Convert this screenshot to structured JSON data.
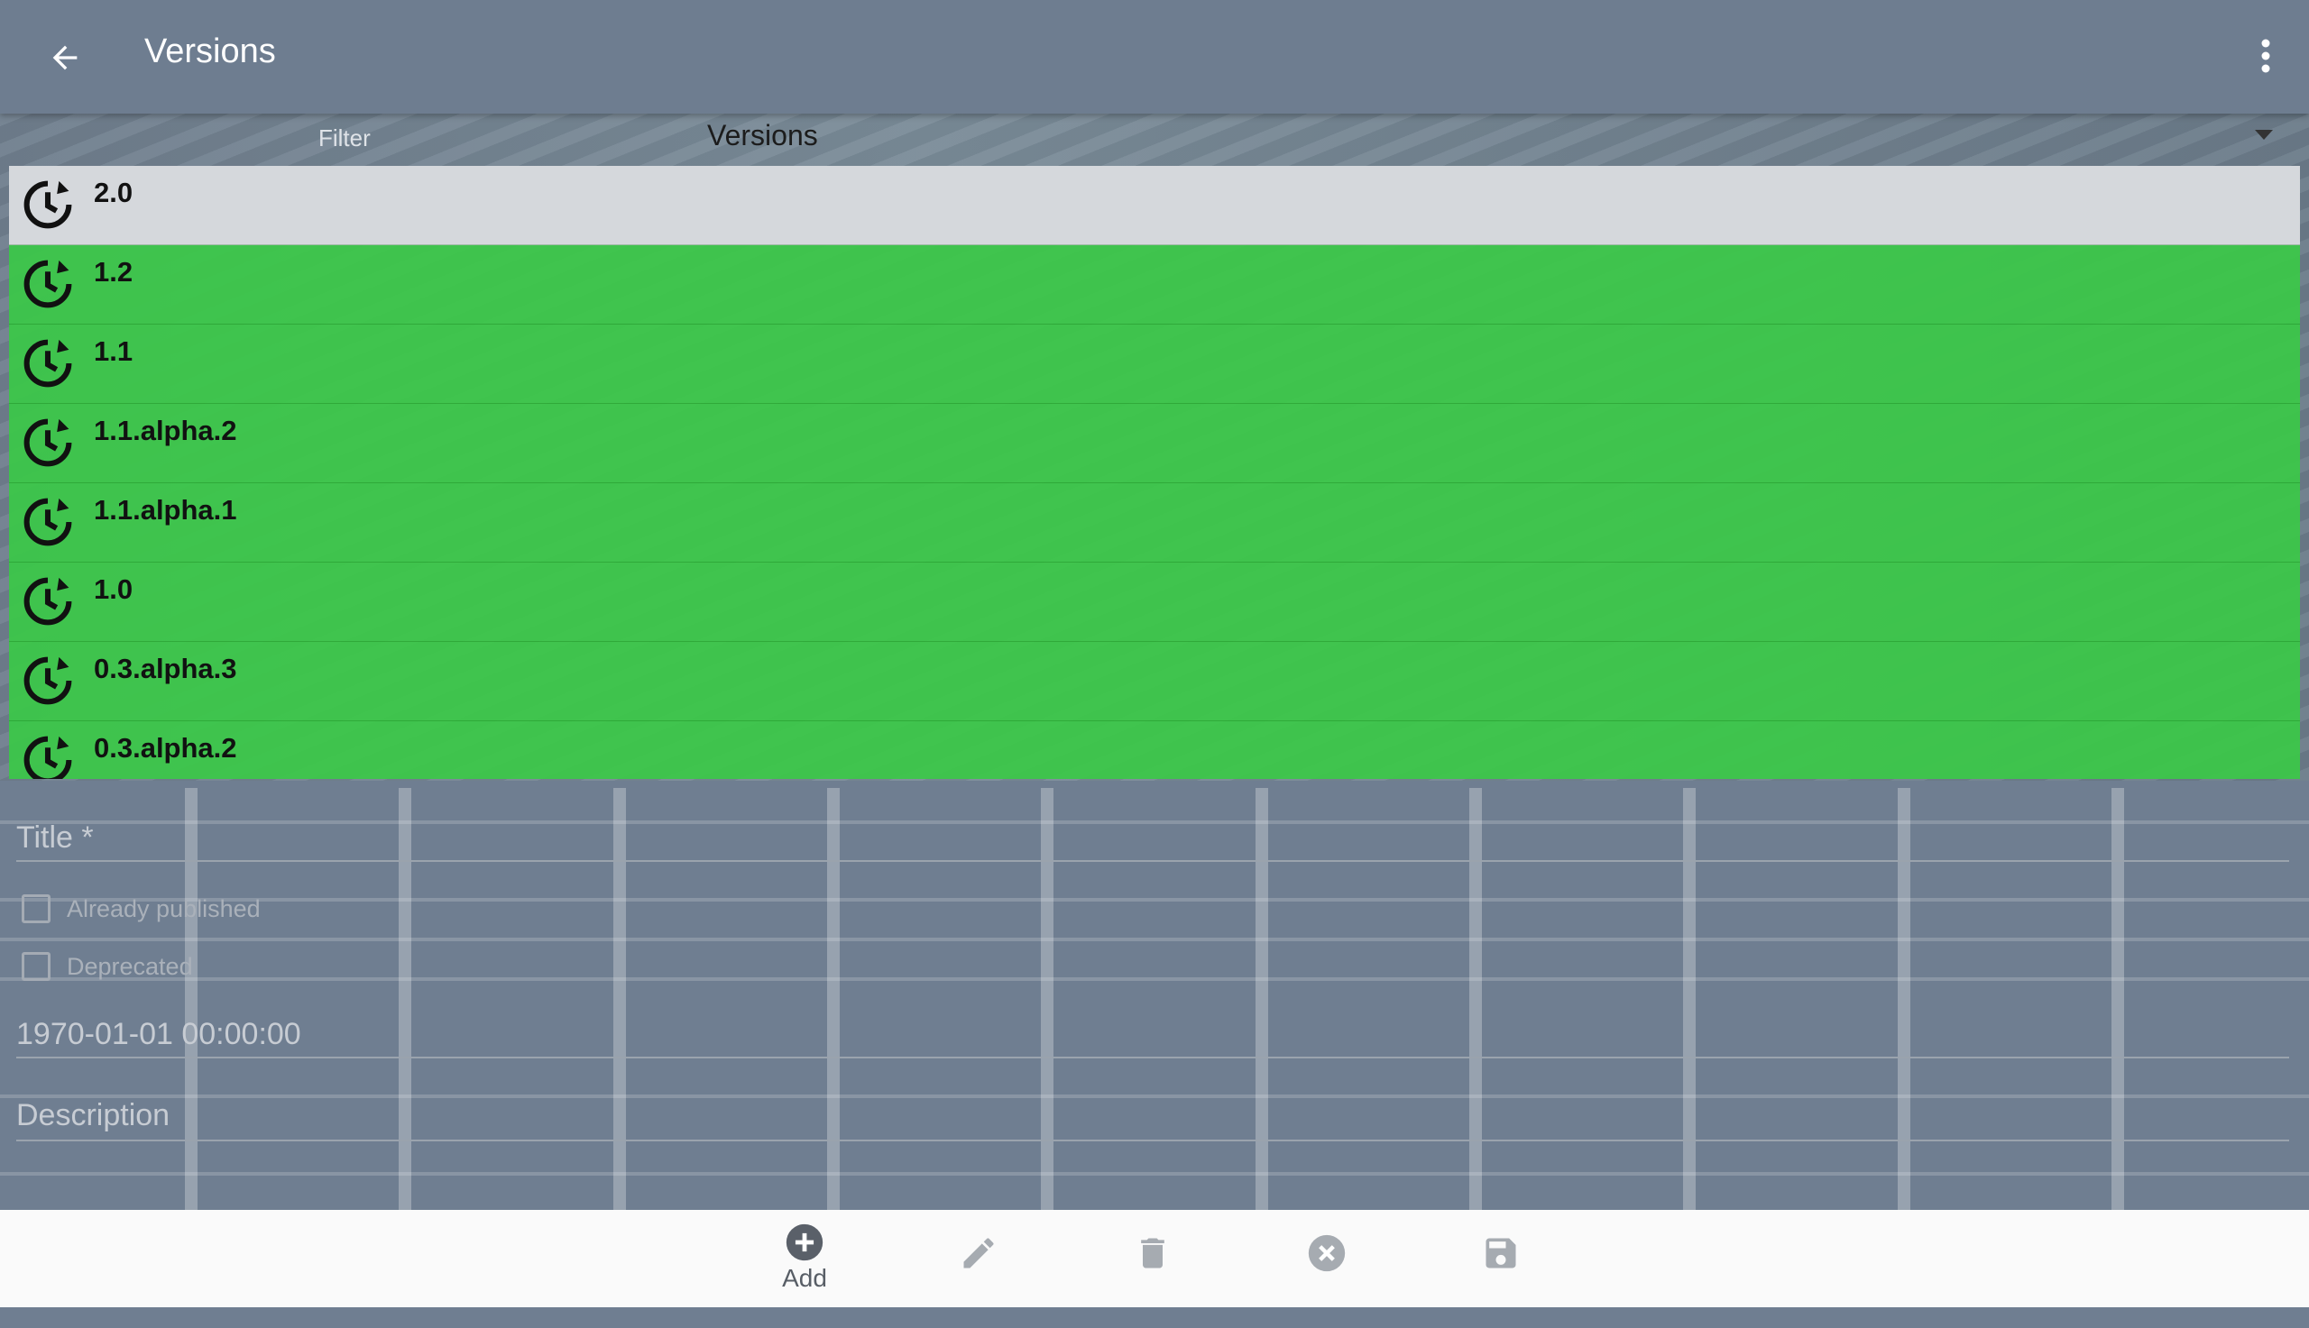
{
  "appbar": {
    "title": "Versions",
    "back_icon": "arrow-back-icon",
    "menu_icon": "more-vert-icon"
  },
  "filter": {
    "label": "Filter",
    "value": "Versions"
  },
  "versions": [
    {
      "label": "2.0",
      "selected": true
    },
    {
      "label": "1.2",
      "selected": false
    },
    {
      "label": "1.1",
      "selected": false
    },
    {
      "label": "1.1.alpha.2",
      "selected": false
    },
    {
      "label": "1.1.alpha.1",
      "selected": false
    },
    {
      "label": "1.0",
      "selected": false
    },
    {
      "label": "0.3.alpha.3",
      "selected": false
    },
    {
      "label": "0.3.alpha.2",
      "selected": false
    }
  ],
  "form": {
    "title_placeholder": "Title *",
    "already_published": "Already published",
    "deprecated": "Deprecated",
    "date_value": "1970-01-01 00:00:00",
    "description_placeholder": "Description"
  },
  "bottombar": {
    "add_label": "Add"
  },
  "colors": {
    "list_green": "#3bc848",
    "selected_row": "#d5d8dc",
    "appbar": "#6e7d90",
    "bottombar": "#fafafa"
  }
}
